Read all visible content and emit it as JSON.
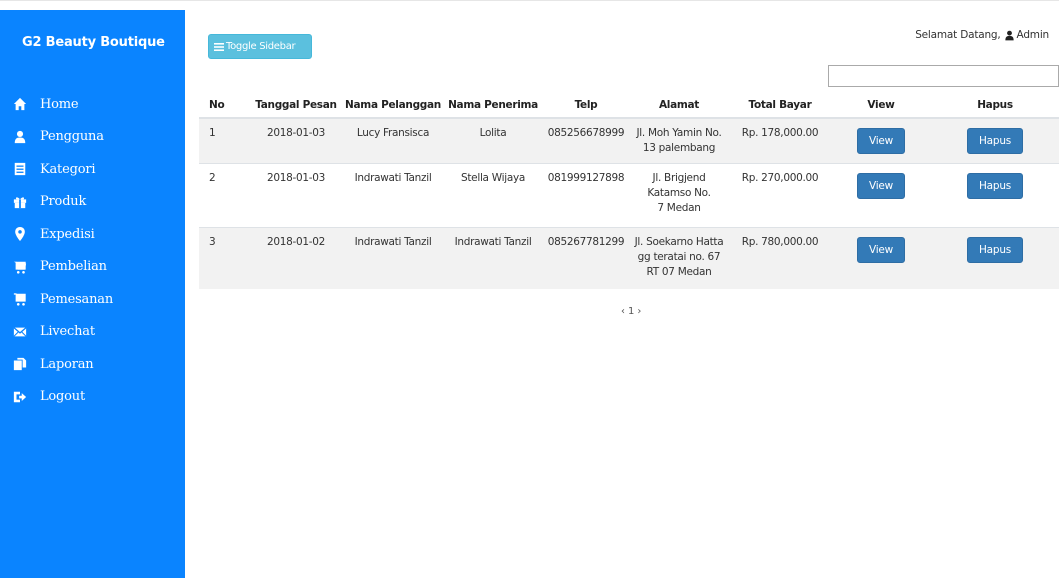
{
  "sidebar": {
    "brand": "G2 Beauty Boutique",
    "items": [
      {
        "label": "Home",
        "icon": "home-icon"
      },
      {
        "label": "Pengguna",
        "icon": "user-icon"
      },
      {
        "label": "Kategori",
        "icon": "list-icon"
      },
      {
        "label": "Produk",
        "icon": "gift-icon"
      },
      {
        "label": "Expedisi",
        "icon": "map-marker-icon"
      },
      {
        "label": "Pembelian",
        "icon": "cart-icon"
      },
      {
        "label": "Pemesanan",
        "icon": "cart-icon"
      },
      {
        "label": "Livechat",
        "icon": "envelope-icon"
      },
      {
        "label": "Laporan",
        "icon": "copy-icon"
      },
      {
        "label": "Logout",
        "icon": "logout-icon"
      }
    ],
    "background": "#0a84ff"
  },
  "header": {
    "toggle_label": "Toggle Sidebar",
    "welcome_prefix": "Selamat Datang,",
    "welcome_user": "Admin",
    "search_value": ""
  },
  "table": {
    "columns": [
      "No",
      "Tanggal Pesan",
      "Nama Pelanggan",
      "Nama Penerima",
      "Telp",
      "Alamat",
      "Total Bayar",
      "View",
      "Hapus"
    ],
    "rows": [
      {
        "no": "1",
        "tanggal": "2018-01-03",
        "pelanggan": "Lucy Fransisca",
        "penerima": "Lolita",
        "telp": "085256678999",
        "alamat": "Jl. Moh Yamin No. 13 palembang",
        "total": "Rp. 178,000.00",
        "view": "View",
        "hapus": "Hapus"
      },
      {
        "no": "2",
        "tanggal": "2018-01-03",
        "pelanggan": "Indrawati Tanzil",
        "penerima": "Stella Wijaya",
        "telp": "081999127898",
        "alamat": "Jl. Brigjend Katamso No. 7 Medan",
        "total": "Rp. 270,000.00",
        "view": "View",
        "hapus": "Hapus"
      },
      {
        "no": "3",
        "tanggal": "2018-01-02",
        "pelanggan": "Indrawati Tanzil",
        "penerima": "Indrawati Tanzil",
        "telp": "085267781299",
        "alamat": "Jl. Soekarno Hatta gg teratai no. 67 RT 07 Medan",
        "total": "Rp. 780,000.00",
        "view": "View",
        "hapus": "Hapus"
      }
    ]
  },
  "pagination": {
    "prev": "‹",
    "page": "1",
    "next": "›"
  }
}
